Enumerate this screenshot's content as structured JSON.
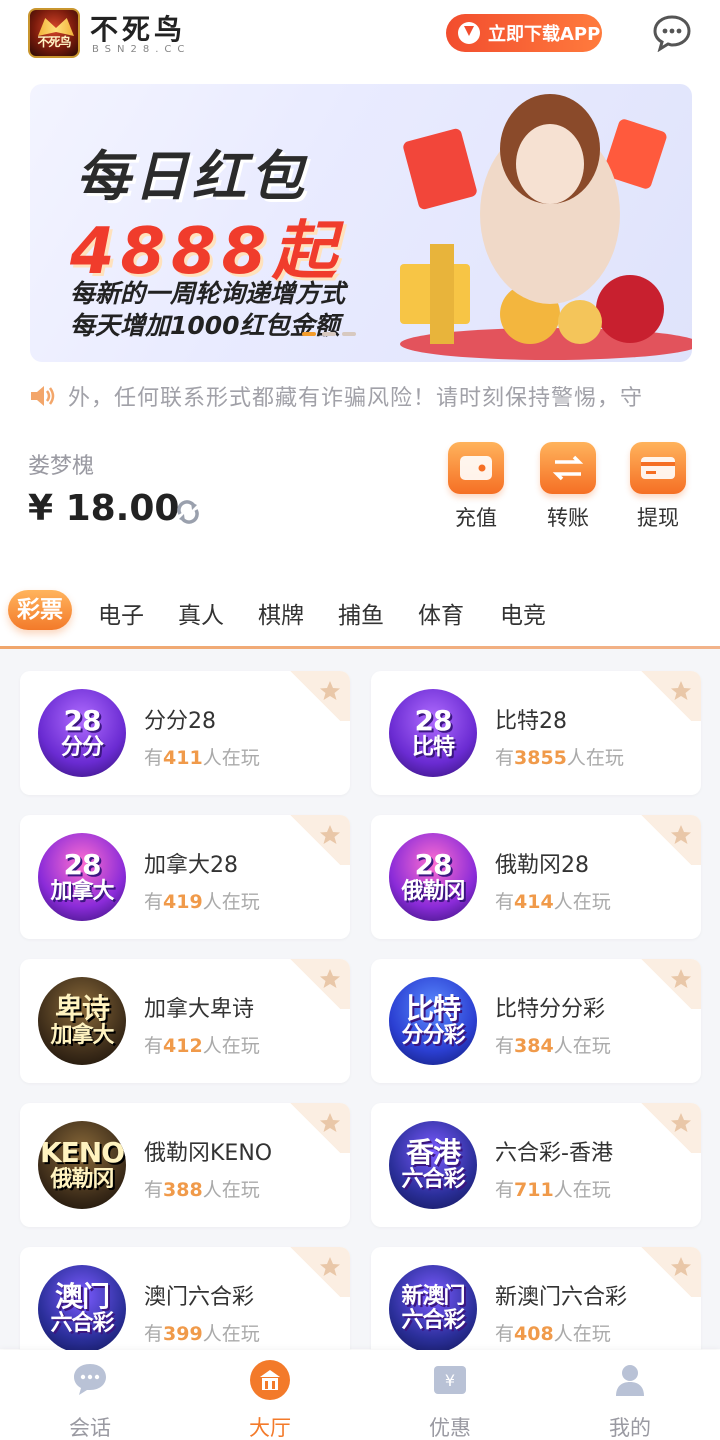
{
  "header": {
    "brand_name": "不死鸟",
    "brand_sub": "BSN28.CC",
    "download_label": "立即下载APP"
  },
  "banner": {
    "title": "每日红包",
    "amount": "4888起",
    "line1": "每新的一周轮询递增方式",
    "line2": "每天增加1000红包金额"
  },
  "notice": {
    "text": "外，任何联系形式都藏有诈骗风险！请时刻保持警惕，守"
  },
  "account": {
    "user_name": "娄梦槐",
    "balance": "¥ 18.00",
    "actions": [
      "充值",
      "转账",
      "提现"
    ]
  },
  "tabs": [
    "彩票",
    "电子",
    "真人",
    "棋牌",
    "捕鱼",
    "体育",
    "电竞"
  ],
  "games": [
    {
      "name": "分分28",
      "prefix": "有",
      "count": "411",
      "suffix": "人在玩",
      "icon_line1": "28",
      "icon_line2": "分分"
    },
    {
      "name": "比特28",
      "prefix": "有",
      "count": "3855",
      "suffix": "人在玩",
      "icon_line1": "28",
      "icon_line2": "比特"
    },
    {
      "name": "加拿大28",
      "prefix": "有",
      "count": "419",
      "suffix": "人在玩",
      "icon_line1": "28",
      "icon_line2": "加拿大"
    },
    {
      "name": "俄勒冈28",
      "prefix": "有",
      "count": "414",
      "suffix": "人在玩",
      "icon_line1": "28",
      "icon_line2": "俄勒冈"
    },
    {
      "name": "加拿大卑诗",
      "prefix": "有",
      "count": "412",
      "suffix": "人在玩",
      "icon_line1": "卑诗",
      "icon_line2": "加拿大"
    },
    {
      "name": "比特分分彩",
      "prefix": "有",
      "count": "384",
      "suffix": "人在玩",
      "icon_line1": "比特",
      "icon_line2": "分分彩"
    },
    {
      "name": "俄勒冈KENO",
      "prefix": "有",
      "count": "388",
      "suffix": "人在玩",
      "icon_line1": "KENO",
      "icon_line2": "俄勒冈"
    },
    {
      "name": "六合彩-香港",
      "prefix": "有",
      "count": "711",
      "suffix": "人在玩",
      "icon_line1": "香港",
      "icon_line2": "六合彩"
    },
    {
      "name": "澳门六合彩",
      "prefix": "有",
      "count": "399",
      "suffix": "人在玩",
      "icon_line1": "澳门",
      "icon_line2": "六合彩"
    },
    {
      "name": "新澳门六合彩",
      "prefix": "有",
      "count": "408",
      "suffix": "人在玩",
      "icon_line1": "新澳门",
      "icon_line2": "六合彩"
    }
  ],
  "bottom_nav": [
    {
      "label": "会话",
      "icon": "chat-icon"
    },
    {
      "label": "大厅",
      "icon": "hall-icon"
    },
    {
      "label": "优惠",
      "icon": "promo-icon"
    },
    {
      "label": "我的",
      "icon": "user-icon"
    }
  ],
  "colors": {
    "accent": "#f37a2a",
    "download": "#f24d2e",
    "count": "#f09a4a"
  }
}
